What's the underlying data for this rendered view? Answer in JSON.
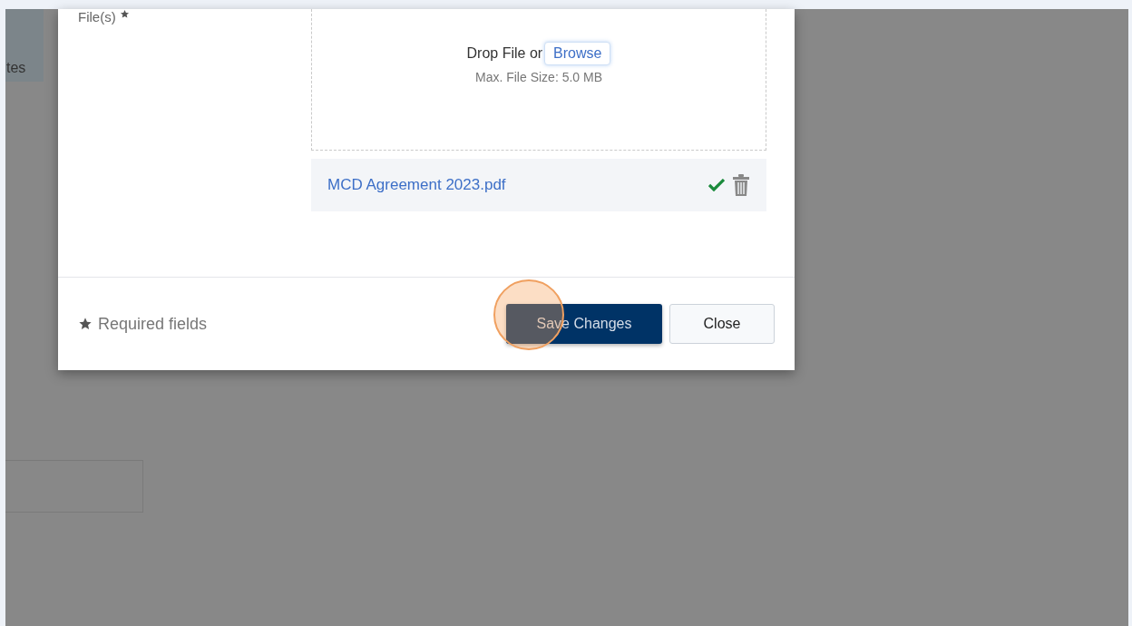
{
  "backdrop": {
    "tab_label": "tes"
  },
  "modal": {
    "field_label": "File(s)",
    "required": true,
    "dropzone": {
      "prompt": "Drop File or",
      "browse_button": "Browse",
      "hint": "Max. File Size: 5.0 MB"
    },
    "files": [
      {
        "name": "MCD Agreement 2023.pdf",
        "uploaded": true
      }
    ],
    "footer": {
      "required_note": "Required fields",
      "buttons": [
        {
          "label": "Save Changes",
          "kind": "primary"
        },
        {
          "label": "Close",
          "kind": "secondary"
        }
      ]
    }
  }
}
